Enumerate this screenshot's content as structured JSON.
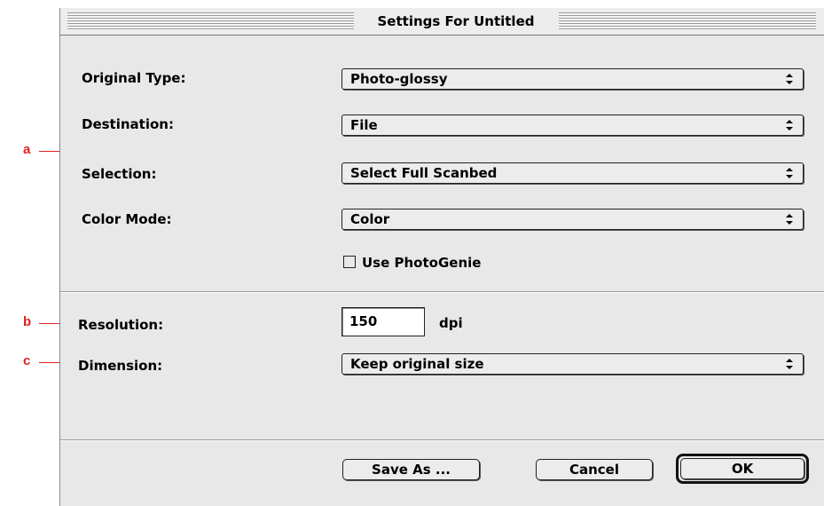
{
  "window": {
    "title": "Settings For Untitled"
  },
  "settings": {
    "original_type": {
      "label": "Original Type:",
      "value": "Photo-glossy"
    },
    "destination": {
      "label": "Destination:",
      "value": "File"
    },
    "selection": {
      "label": "Selection:",
      "value": "Select Full Scanbed"
    },
    "color_mode": {
      "label": "Color Mode:",
      "value": "Color"
    },
    "photogenie": {
      "label": "Use PhotoGenie",
      "checked": false
    }
  },
  "output": {
    "resolution": {
      "label": "Resolution:",
      "value": "150",
      "unit": "dpi"
    },
    "dimension": {
      "label": "Dimension:",
      "value": "Keep original size"
    }
  },
  "buttons": {
    "save_as": "Save As ...",
    "cancel": "Cancel",
    "ok": "OK"
  },
  "annotations": {
    "a": "a",
    "b": "b",
    "c": "c",
    "color": "#e02020"
  },
  "icons": [
    "popup-arrows-icon"
  ]
}
